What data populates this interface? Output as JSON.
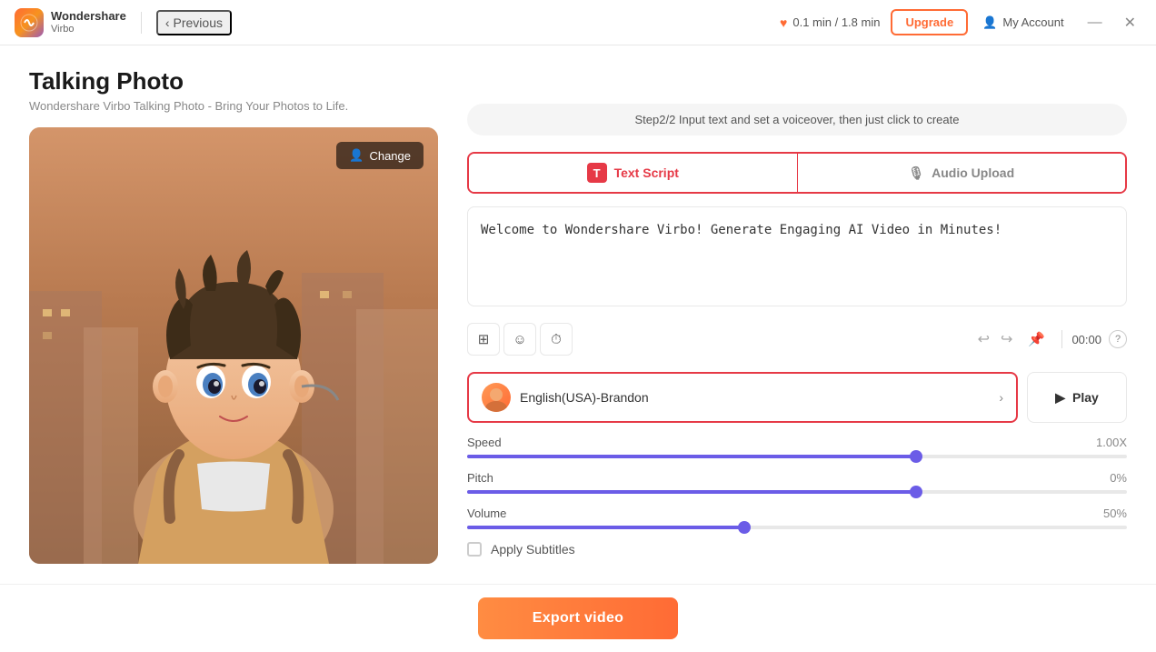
{
  "titlebar": {
    "logo_brand": "Wondershare",
    "logo_product": "Virbo",
    "logo_letter": "W",
    "back_label": "Previous",
    "credits_label": "0.1 min / 1.8 min",
    "upgrade_label": "Upgrade",
    "my_account_label": "My Account",
    "minimize_icon": "—",
    "close_icon": "✕"
  },
  "page": {
    "title": "Talking Photo",
    "subtitle": "Wondershare Virbo Talking Photo - Bring Your Photos to Life.",
    "step_hint": "Step2/2 Input text and set a voiceover, then just click to create",
    "change_label": "Change"
  },
  "tabs": {
    "text_script_label": "Text Script",
    "text_script_icon": "T",
    "audio_upload_label": "Audio Upload",
    "audio_upload_icon": "🎤"
  },
  "script": {
    "content": "Welcome to Wondershare Virbo! Generate Engaging AI Video in Minutes!"
  },
  "toolbar": {
    "import_icon": "⊞",
    "emoji_icon": "☺",
    "timer_icon": "⏱",
    "undo_icon": "↩",
    "redo_icon": "↪",
    "pin_icon": "📌",
    "time_display": "00:00",
    "help_icon": "?"
  },
  "voice": {
    "name": "English(USA)-Brandon",
    "play_label": "Play"
  },
  "sliders": {
    "speed_label": "Speed",
    "speed_value": "1.00X",
    "speed_percent": 68,
    "pitch_label": "Pitch",
    "pitch_value": "0%",
    "pitch_percent": 68,
    "volume_label": "Volume",
    "volume_value": "50%",
    "volume_percent": 42
  },
  "subtitles": {
    "label": "Apply Subtitles"
  },
  "export": {
    "label": "Export video"
  }
}
